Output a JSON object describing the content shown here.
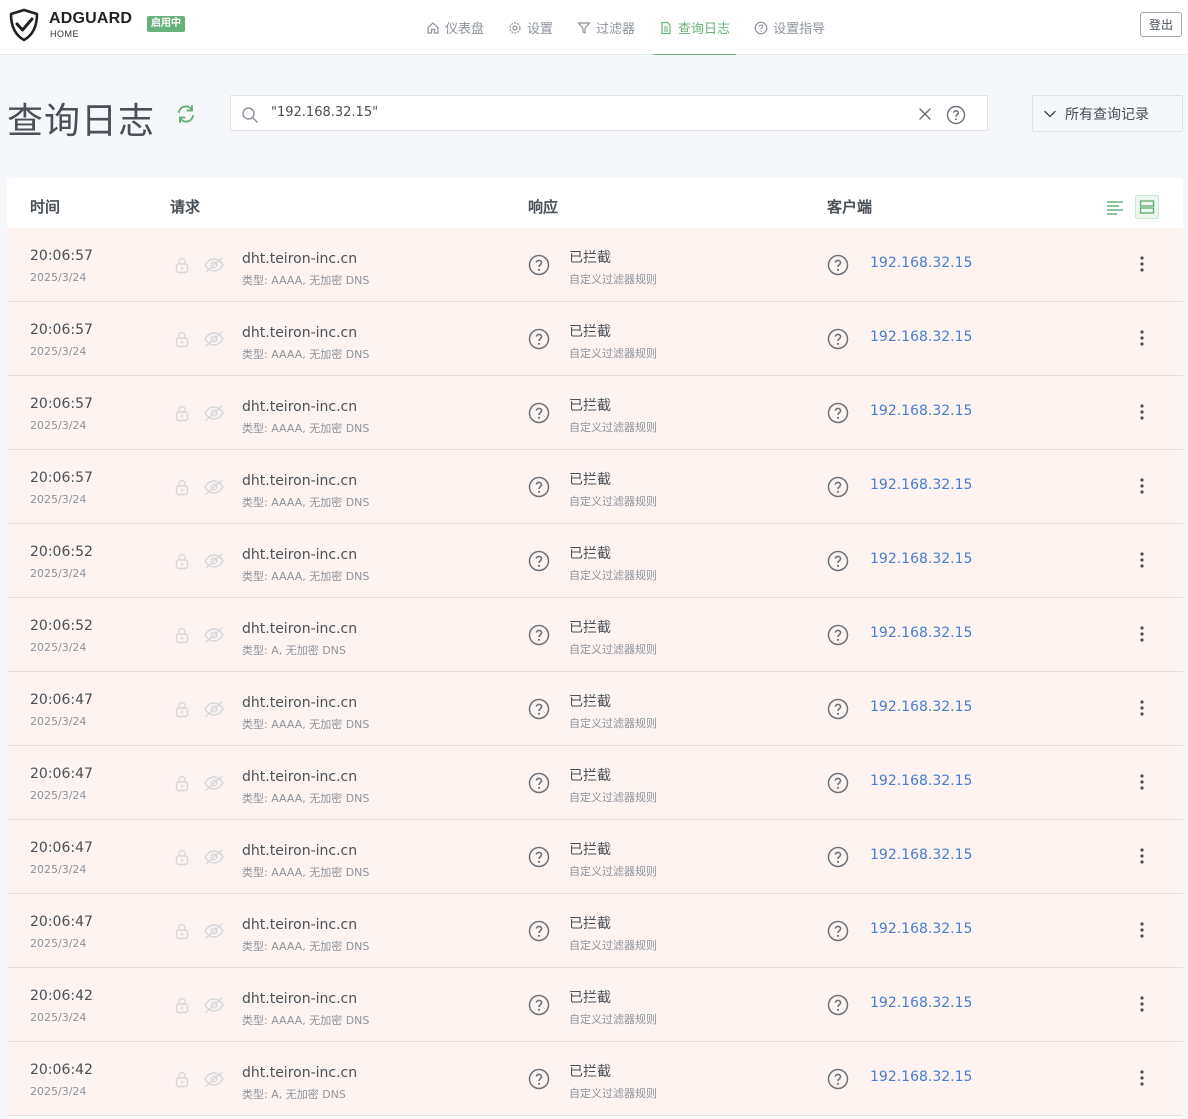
{
  "header": {
    "brand": "ADGUARD",
    "brand_sub": "HOME",
    "badge": "启用中",
    "logout": "登出",
    "nav": [
      {
        "label": "仪表盘",
        "icon": "home-icon"
      },
      {
        "label": "设置",
        "icon": "gear-icon"
      },
      {
        "label": "过滤器",
        "icon": "filter-icon"
      },
      {
        "label": "查询日志",
        "icon": "document-icon",
        "active": true
      },
      {
        "label": "设置指导",
        "icon": "help-icon"
      }
    ]
  },
  "page": {
    "title": "查询日志",
    "search_value": "\"192.168.32.15\"",
    "filter_label": "所有查询记录"
  },
  "table": {
    "headers": {
      "time": "时间",
      "request": "请求",
      "response": "响应",
      "client": "客户端"
    },
    "rows": [
      {
        "time": "20:06:57",
        "date": "2025/3/24",
        "domain": "dht.teiron-inc.cn",
        "type": "类型: AAAA, 无加密 DNS",
        "status": "已拦截",
        "rule": "自定义过滤器规则",
        "client": "192.168.32.15"
      },
      {
        "time": "20:06:57",
        "date": "2025/3/24",
        "domain": "dht.teiron-inc.cn",
        "type": "类型: AAAA, 无加密 DNS",
        "status": "已拦截",
        "rule": "自定义过滤器规则",
        "client": "192.168.32.15"
      },
      {
        "time": "20:06:57",
        "date": "2025/3/24",
        "domain": "dht.teiron-inc.cn",
        "type": "类型: AAAA, 无加密 DNS",
        "status": "已拦截",
        "rule": "自定义过滤器规则",
        "client": "192.168.32.15"
      },
      {
        "time": "20:06:57",
        "date": "2025/3/24",
        "domain": "dht.teiron-inc.cn",
        "type": "类型: AAAA, 无加密 DNS",
        "status": "已拦截",
        "rule": "自定义过滤器规则",
        "client": "192.168.32.15"
      },
      {
        "time": "20:06:52",
        "date": "2025/3/24",
        "domain": "dht.teiron-inc.cn",
        "type": "类型: AAAA, 无加密 DNS",
        "status": "已拦截",
        "rule": "自定义过滤器规则",
        "client": "192.168.32.15"
      },
      {
        "time": "20:06:52",
        "date": "2025/3/24",
        "domain": "dht.teiron-inc.cn",
        "type": "类型: A, 无加密 DNS",
        "status": "已拦截",
        "rule": "自定义过滤器规则",
        "client": "192.168.32.15"
      },
      {
        "time": "20:06:47",
        "date": "2025/3/24",
        "domain": "dht.teiron-inc.cn",
        "type": "类型: AAAA, 无加密 DNS",
        "status": "已拦截",
        "rule": "自定义过滤器规则",
        "client": "192.168.32.15"
      },
      {
        "time": "20:06:47",
        "date": "2025/3/24",
        "domain": "dht.teiron-inc.cn",
        "type": "类型: AAAA, 无加密 DNS",
        "status": "已拦截",
        "rule": "自定义过滤器规则",
        "client": "192.168.32.15"
      },
      {
        "time": "20:06:47",
        "date": "2025/3/24",
        "domain": "dht.teiron-inc.cn",
        "type": "类型: AAAA, 无加密 DNS",
        "status": "已拦截",
        "rule": "自定义过滤器规则",
        "client": "192.168.32.15"
      },
      {
        "time": "20:06:47",
        "date": "2025/3/24",
        "domain": "dht.teiron-inc.cn",
        "type": "类型: AAAA, 无加密 DNS",
        "status": "已拦截",
        "rule": "自定义过滤器规则",
        "client": "192.168.32.15"
      },
      {
        "time": "20:06:42",
        "date": "2025/3/24",
        "domain": "dht.teiron-inc.cn",
        "type": "类型: AAAA, 无加密 DNS",
        "status": "已拦截",
        "rule": "自定义过滤器规则",
        "client": "192.168.32.15"
      },
      {
        "time": "20:06:42",
        "date": "2025/3/24",
        "domain": "dht.teiron-inc.cn",
        "type": "类型: A, 无加密 DNS",
        "status": "已拦截",
        "rule": "自定义过滤器规则",
        "client": "192.168.32.15"
      }
    ]
  },
  "colors": {
    "accent": "#67b279",
    "link": "#467fcf",
    "blocked_row": "#fdf3f1"
  }
}
